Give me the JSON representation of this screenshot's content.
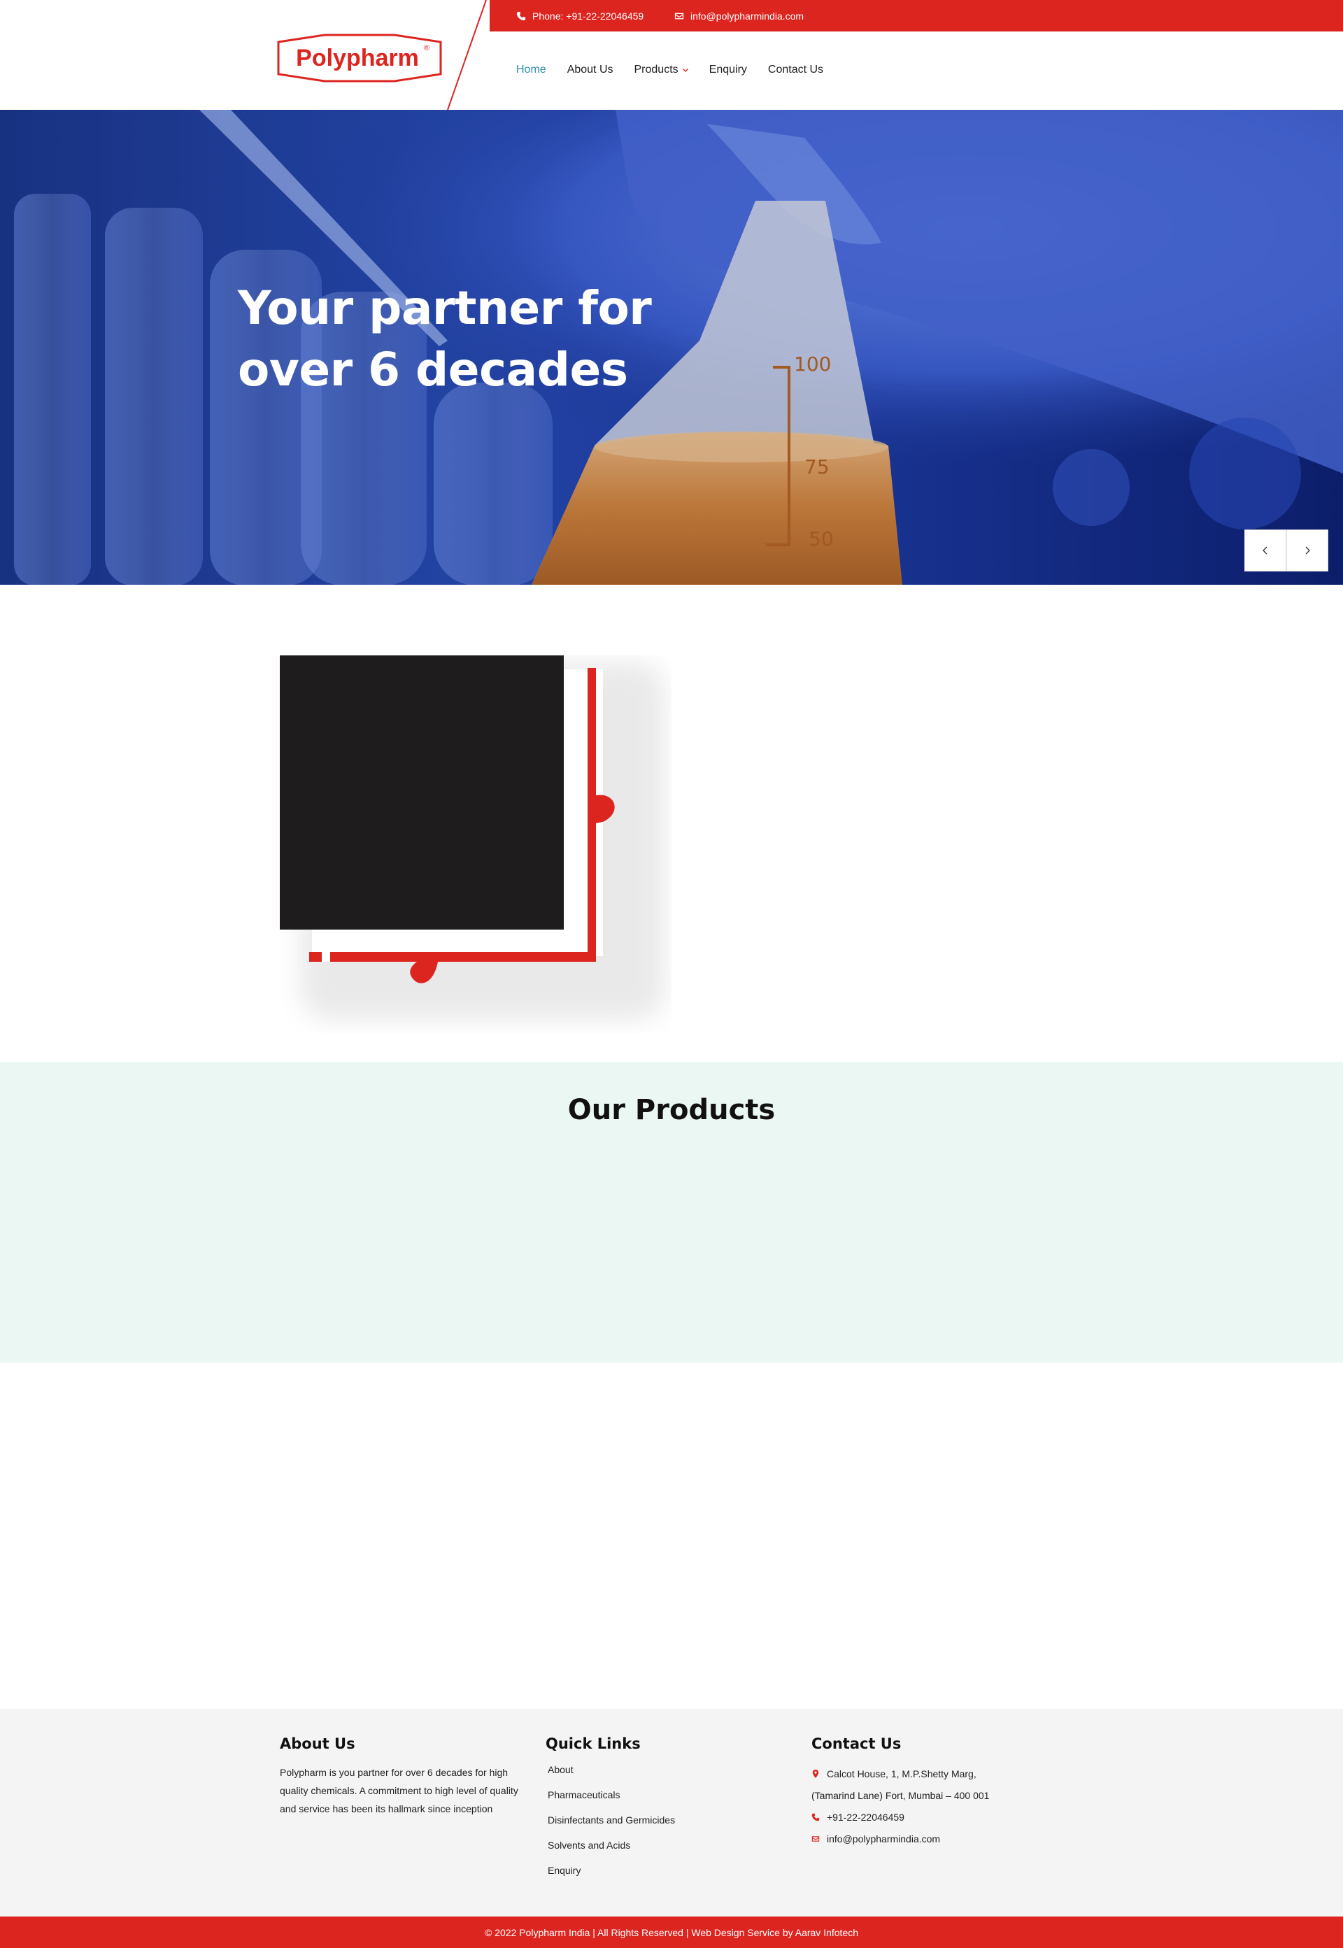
{
  "header": {
    "phone_text": "Phone: +91-22-22046459",
    "email_text": "info@polypharmindia.com",
    "logo_text": "Polypharm",
    "logo_mark": "®",
    "nav": {
      "home": "Home",
      "about": "About Us",
      "products": "Products",
      "enquiry": "Enquiry",
      "contact": "Contact Us"
    },
    "active_nav": "Home"
  },
  "hero": {
    "title_line1": "Your partner for",
    "title_line2": "over 6 decades",
    "prev_icon": "chevron-left-icon",
    "next_icon": "chevron-right-icon"
  },
  "products": {
    "title": "Our Products"
  },
  "footer": {
    "about": {
      "title": "About Us",
      "text": "Polypharm is you partner for over 6 decades for high quality chemicals. A commitment to high level of quality and service has been its hallmark since inception"
    },
    "quick_links": {
      "title": "Quick Links",
      "links": [
        "About",
        "Pharmaceuticals",
        "Disinfectants and Germicides",
        "Solvents and Acids",
        "Enquiry"
      ]
    },
    "contact": {
      "title": "Contact Us",
      "address_line1": "Calcot House, 1, M.P.Shetty Marg,",
      "address_line2": "(Tamarind Lane) Fort, Mumbai – 400 001",
      "phone": "+91-22-22046459",
      "email": "info@polypharmindia.com"
    }
  },
  "copyright": "© 2022 Polypharm India | All Rights Reserved | Web Design Service by Aarav Infotech",
  "colors": {
    "brand_red": "#dd2520",
    "nav_active": "#2a8fa8",
    "products_bg": "#ebf7f3",
    "footer_bg": "#f4f4f4"
  }
}
